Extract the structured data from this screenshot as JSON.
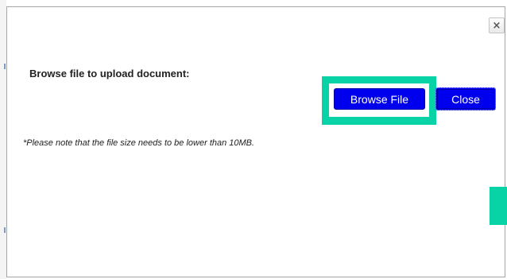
{
  "dialog": {
    "close_icon": "×",
    "prompt": "Browse file to upload document:",
    "browse_label": "Browse File",
    "close_label": "Close",
    "note": "*Please note that the file size needs to be lower than 10MB."
  },
  "colors": {
    "button_blue": "#0000ee",
    "highlight_teal": "#08d3a6"
  },
  "icons": {
    "close": "close-icon"
  }
}
